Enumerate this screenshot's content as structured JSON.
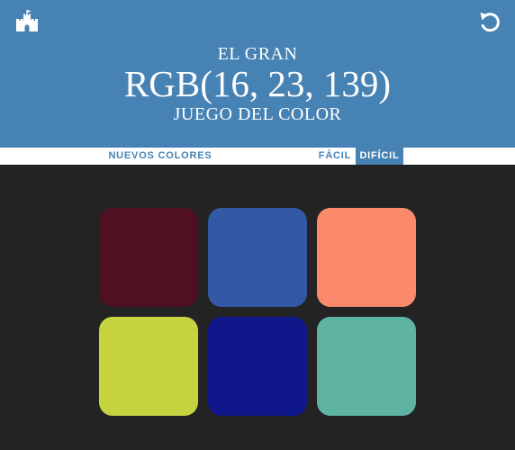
{
  "header": {
    "line1": "EL GRAN",
    "rgb_display": "RGB(16, 23, 139)",
    "line3": "JUEGO DEL COLOR",
    "background_color": "#4682b4",
    "home_icon": "castle-icon",
    "reset_icon": "refresh-icon"
  },
  "controls": {
    "new_colors_label": "NUEVOS COLORES",
    "easy_label": "FÁCIL",
    "hard_label": "DIFÍCIL",
    "selected_mode": "DIFÍCIL",
    "accent_color": "#4682b4"
  },
  "squares": [
    {
      "color": "#4f1121"
    },
    {
      "color": "#3258a6"
    },
    {
      "color": "#fb8a6d"
    },
    {
      "color": "#c5d43e"
    },
    {
      "color": "#10178b"
    },
    {
      "color": "#5eb3a3"
    }
  ],
  "page_background": "#232323"
}
